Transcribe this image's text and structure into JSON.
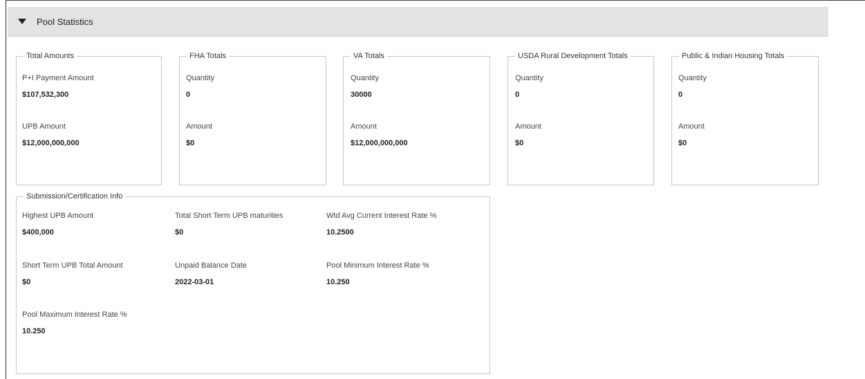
{
  "header": {
    "title": "Pool Statistics"
  },
  "total_amounts": {
    "legend": "Total Amounts",
    "pi_label": "P+I Payment Amount",
    "pi_value": "$107,532,300",
    "upb_label": "UPB Amount",
    "upb_value": "$12,000,000,000"
  },
  "fha": {
    "legend": "FHA Totals",
    "qty_label": "Quantity",
    "qty_value": "0",
    "amt_label": "Amount",
    "amt_value": "$0"
  },
  "va": {
    "legend": "VA Totals",
    "qty_label": "Quantity",
    "qty_value": "30000",
    "amt_label": "Amount",
    "amt_value": "$12,000,000,000"
  },
  "usda": {
    "legend": "USDA Rural Development Totals",
    "qty_label": "Quantity",
    "qty_value": "0",
    "amt_label": "Amount",
    "amt_value": "$0"
  },
  "pih": {
    "legend": "Public & Indian Housing Totals",
    "qty_label": "Quantity",
    "qty_value": "0",
    "amt_label": "Amount",
    "amt_value": "$0"
  },
  "submission": {
    "legend": "Submission/Certification Info",
    "highest_upb_label": "Highest UPB Amount",
    "highest_upb_value": "$400,000",
    "total_short_term_label": "Total Short Term UPB maturities",
    "total_short_term_value": "$0",
    "wtd_avg_label": "Wtd Avg Current Interest Rate %",
    "wtd_avg_value": "10.2500",
    "short_term_total_label": "Short Term UPB Total Amount",
    "short_term_total_value": "$0",
    "unpaid_date_label": "Unpaid Balance Date",
    "unpaid_date_value": "2022-03-01",
    "pool_min_label": "Pool Minimum Interest Rate %",
    "pool_min_value": "10.250",
    "pool_max_label": "Pool Maximum Interest Rate %",
    "pool_max_value": "10.250"
  }
}
